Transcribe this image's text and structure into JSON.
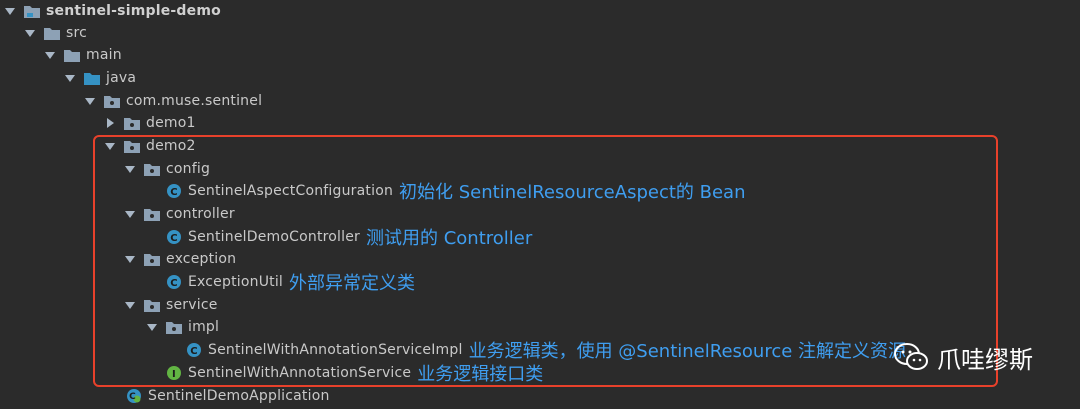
{
  "tree": {
    "project": "sentinel-simple-demo",
    "src": "src",
    "main": "main",
    "java": "java",
    "package": "com.muse.sentinel",
    "demo1": "demo1",
    "demo2": "demo2",
    "config": "config",
    "config_class": "SentinelAspectConfiguration",
    "config_note": "初始化 SentinelResourceAspect的 Bean",
    "controller": "controller",
    "controller_class": "SentinelDemoController",
    "controller_note": "测试用的 Controller",
    "exception": "exception",
    "exception_class": "ExceptionUtil",
    "exception_note": "外部异常定义类",
    "service": "service",
    "impl": "impl",
    "impl_class": "SentinelWithAnnotationServiceImpl",
    "impl_note": "业务逻辑类，使用 @SentinelResource 注解定义资源",
    "service_interface": "SentinelWithAnnotationService",
    "service_interface_note": "业务逻辑接口类",
    "app_class": "SentinelDemoApplication"
  },
  "watermark": {
    "text": "爪哇缪斯",
    "icon": "wechat-icon"
  },
  "colors": {
    "background": "#2b2b2b",
    "annotation": "#3f9ef0",
    "highlight_border": "#e8412b",
    "folder": "#8da1b5",
    "class_icon": "#3592c4",
    "interface_icon": "#62b543"
  }
}
